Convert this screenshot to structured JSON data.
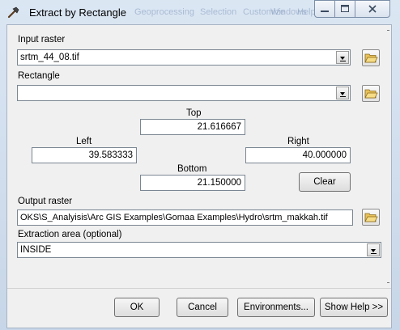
{
  "window": {
    "title": "Extract by Rectangle",
    "faint_menu": [
      "Geoprocessing",
      "Selection",
      "Customize",
      "Windows",
      "Help"
    ],
    "accent_color": "#1c5fa8"
  },
  "form": {
    "input_raster": {
      "label": "Input raster",
      "value": "srtm_44_08.tif"
    },
    "rectangle": {
      "label": "Rectangle",
      "value": ""
    },
    "extent": {
      "top": {
        "label": "Top",
        "value": "21.616667"
      },
      "left": {
        "label": "Left",
        "value": "39.583333"
      },
      "right": {
        "label": "Right",
        "value": "40.000000"
      },
      "bottom": {
        "label": "Bottom",
        "value": "21.150000"
      },
      "clear_label": "Clear"
    },
    "output_raster": {
      "label": "Output raster",
      "value": "OKS\\S_Analyisis\\Arc GIS Examples\\Gomaa Examples\\Hydro\\srtm_makkah.tif"
    },
    "extraction_area": {
      "label": "Extraction area (optional)",
      "value": "INSIDE"
    }
  },
  "buttons": {
    "ok": "OK",
    "cancel": "Cancel",
    "environments": "Environments...",
    "show_help": "Show Help >>"
  },
  "icons": {
    "title": "hammer-icon",
    "folder": "open-folder-icon"
  }
}
